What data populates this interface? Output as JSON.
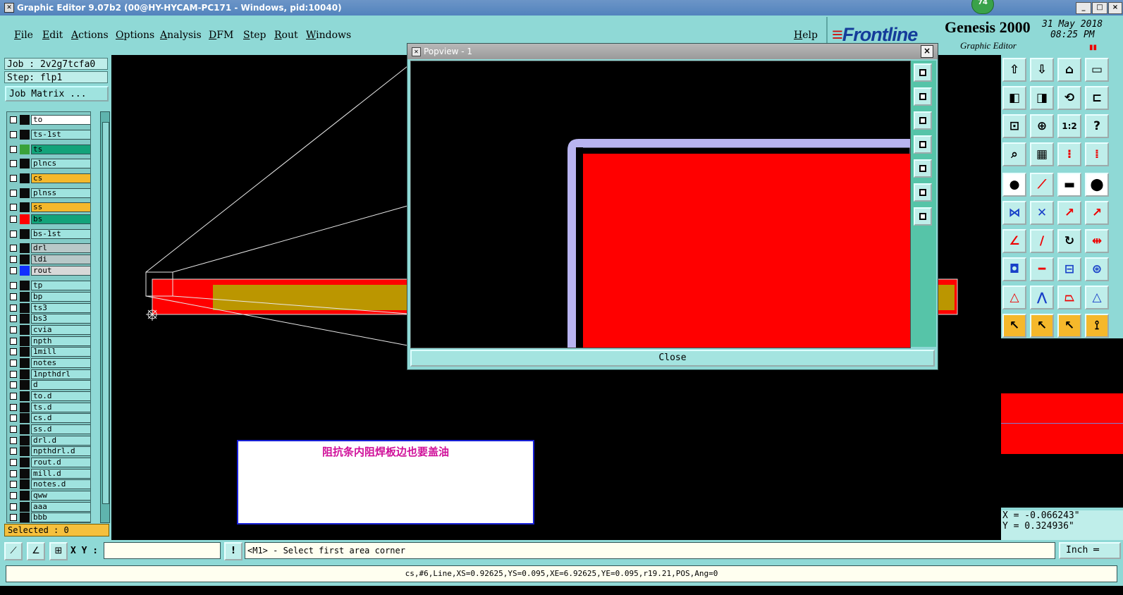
{
  "window": {
    "title": "Graphic Editor 9.07b2 (00@HY-HYCAM-PC171 - Windows, pid:10040)",
    "badge": "74"
  },
  "menubar": {
    "items": [
      "File",
      "Edit",
      "Actions",
      "Options",
      "Analysis",
      "DFM",
      "Step",
      "Rout",
      "Windows"
    ],
    "help": "Help"
  },
  "brand": {
    "logo": "Frontline",
    "app": "Genesis 2000",
    "subtitle": "Graphic Editor",
    "date": "31 May 2018",
    "time": "08:25 PM"
  },
  "job": {
    "job_label": "Job : 2v2g7tcfa0",
    "step_label": "Step: flp1",
    "matrix_button": "Job Matrix ...",
    "selected": "Selected : 0"
  },
  "layers": [
    {
      "name": "to",
      "color": "#ffffff",
      "swatch": ""
    },
    {
      "name": "ts-1st",
      "color": "#9fe3df",
      "swatch": ""
    },
    {
      "name": "ts",
      "color": "#13a37a",
      "swatch": "#3aa23a"
    },
    {
      "name": "plncs",
      "color": "#9fe3df",
      "swatch": ""
    },
    {
      "name": "cs",
      "color": "#f5b82b",
      "swatch": ""
    },
    {
      "name": "plnss",
      "color": "#9fe3df",
      "swatch": ""
    },
    {
      "name": "ss",
      "color": "#f5b82b",
      "swatch": ""
    },
    {
      "name": "bs",
      "color": "#13a37a",
      "swatch": "#ff0000"
    },
    {
      "name": "bs-1st",
      "color": "#9fe3df",
      "swatch": ""
    },
    {
      "name": "drl",
      "color": "#b8c8c8",
      "swatch": ""
    },
    {
      "name": "ldi",
      "color": "#b8c8c8",
      "swatch": ""
    },
    {
      "name": "rout",
      "color": "#d8d8d8",
      "swatch": "#1030ff"
    },
    {
      "name": "tp",
      "color": "#9fe3df",
      "swatch": ""
    },
    {
      "name": "bp",
      "color": "#9fe3df",
      "swatch": ""
    },
    {
      "name": "ts3",
      "color": "#9fe3df",
      "swatch": ""
    },
    {
      "name": "bs3",
      "color": "#9fe3df",
      "swatch": ""
    },
    {
      "name": "cvia",
      "color": "#9fe3df",
      "swatch": ""
    },
    {
      "name": "npth",
      "color": "#9fe3df",
      "swatch": ""
    },
    {
      "name": "1mill",
      "color": "#9fe3df",
      "swatch": ""
    },
    {
      "name": "notes",
      "color": "#9fe3df",
      "swatch": ""
    },
    {
      "name": "1npthdrl",
      "color": "#9fe3df",
      "swatch": ""
    },
    {
      "name": "d",
      "color": "#9fe3df",
      "swatch": ""
    },
    {
      "name": "to.d",
      "color": "#9fe3df",
      "swatch": ""
    },
    {
      "name": "ts.d",
      "color": "#9fe3df",
      "swatch": ""
    },
    {
      "name": "cs.d",
      "color": "#9fe3df",
      "swatch": ""
    },
    {
      "name": "ss.d",
      "color": "#9fe3df",
      "swatch": ""
    },
    {
      "name": "drl.d",
      "color": "#9fe3df",
      "swatch": ""
    },
    {
      "name": "npthdrl.d",
      "color": "#9fe3df",
      "swatch": ""
    },
    {
      "name": "rout.d",
      "color": "#9fe3df",
      "swatch": ""
    },
    {
      "name": "mill.d",
      "color": "#9fe3df",
      "swatch": ""
    },
    {
      "name": "notes.d",
      "color": "#9fe3df",
      "swatch": ""
    },
    {
      "name": "qww",
      "color": "#9fe3df",
      "swatch": ""
    },
    {
      "name": "aaa",
      "color": "#9fe3df",
      "swatch": ""
    },
    {
      "name": "bbb",
      "color": "#9fe3df",
      "swatch": ""
    }
  ],
  "annotation": {
    "text": "阻抗条内阻焊板边也要盖油"
  },
  "popview": {
    "title": "Popview - 1",
    "close_label": "Close",
    "close_x": "×"
  },
  "coords": {
    "x": "X = -0.066243\"",
    "y": "Y = 0.324936\""
  },
  "bottom": {
    "xy_label": "X Y :",
    "xy_value": "",
    "prompt": "<M1> - Select first area corner",
    "units": "Inch",
    "status": "cs,#6,Line,XS=0.92625,YS=0.095,XE=6.92625,YE=0.095,r19.21,POS,Ang=0"
  },
  "colors": {
    "panel": "#8fd9d6",
    "copper_red": "#ff0000",
    "gold": "#bb9600",
    "outline": "#b8b4f0"
  }
}
